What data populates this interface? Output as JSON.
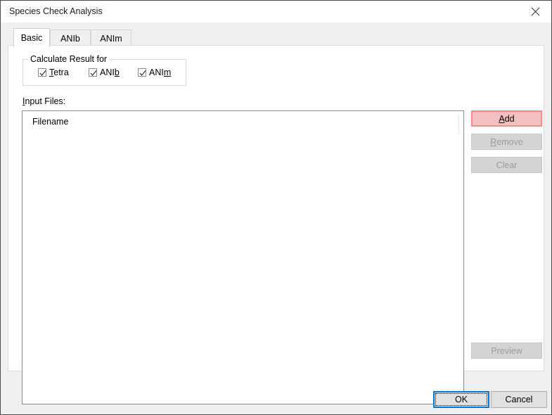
{
  "window": {
    "title": "Species Check Analysis",
    "close_icon": "close-icon"
  },
  "tabs": [
    {
      "label": "Basic",
      "active": true
    },
    {
      "label": "ANIb",
      "active": false
    },
    {
      "label": "ANIm",
      "active": false
    }
  ],
  "basic_tab": {
    "group": {
      "legend": "Calculate Result for",
      "checkboxes": [
        {
          "label_before": "",
          "mnemonic": "T",
          "label_after": "etra",
          "checked": true
        },
        {
          "label_before": "ANI",
          "mnemonic": "b",
          "label_after": "",
          "checked": true
        },
        {
          "label_before": "ANI",
          "mnemonic": "m",
          "label_after": "",
          "checked": true
        }
      ]
    },
    "input_files": {
      "label_mnemonic": "I",
      "label_rest": "nput Files:",
      "column_header": "Filename",
      "rows": []
    },
    "side_buttons": [
      {
        "mnemonic": "A",
        "rest": "dd",
        "state": "highlighted"
      },
      {
        "mnemonic": "R",
        "rest": "emove",
        "state": "disabled"
      },
      {
        "mnemonic": "",
        "rest": "Clear",
        "state": "disabled"
      },
      {
        "mnemonic": "",
        "rest": "Preview",
        "state": "disabled"
      }
    ]
  },
  "footer": {
    "ok_label": "OK",
    "cancel_label": "Cancel"
  },
  "colors": {
    "dialog_background": "#f0f0f0",
    "panel_background": "#ffffff",
    "accent_focus_blue": "#0078d7",
    "add_button_fill": "#f4bfbf",
    "add_button_border": "#fa8a8a",
    "button_face": "#d4d4d4",
    "disabled_text": "#9a9a9a"
  }
}
